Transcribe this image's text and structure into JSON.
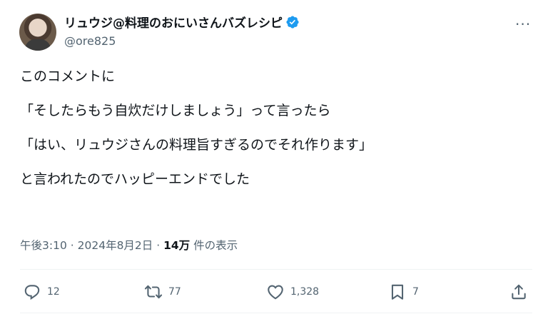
{
  "tweet": {
    "author_name": "リュウジ@料理のおにいさんバズレシピ",
    "handle": "@ore825",
    "more_label": "···",
    "lines": [
      "このコメントに",
      "「そしたらもう自炊だけしましょう」って言ったら",
      "「はい、リュウジさんの料理旨すぎるのでそれ作ります」",
      "と言われたのでハッピーエンドでした"
    ],
    "time": "午後3:10",
    "date": "2024年8月2日",
    "separator": "·",
    "views_count": "14万",
    "views_label": "件の表示"
  },
  "actions": {
    "replies": "12",
    "retweets": "77",
    "likes": "1,328",
    "bookmarks": "7"
  },
  "colors": {
    "text": "#0f1419",
    "muted": "#536471",
    "verified": "#1d9bf0",
    "divider": "#eff3f4"
  },
  "icons": [
    "avatar",
    "verified-badge-icon",
    "more-icon",
    "reply-icon",
    "retweet-icon",
    "like-icon",
    "bookmark-icon",
    "share-icon"
  ]
}
